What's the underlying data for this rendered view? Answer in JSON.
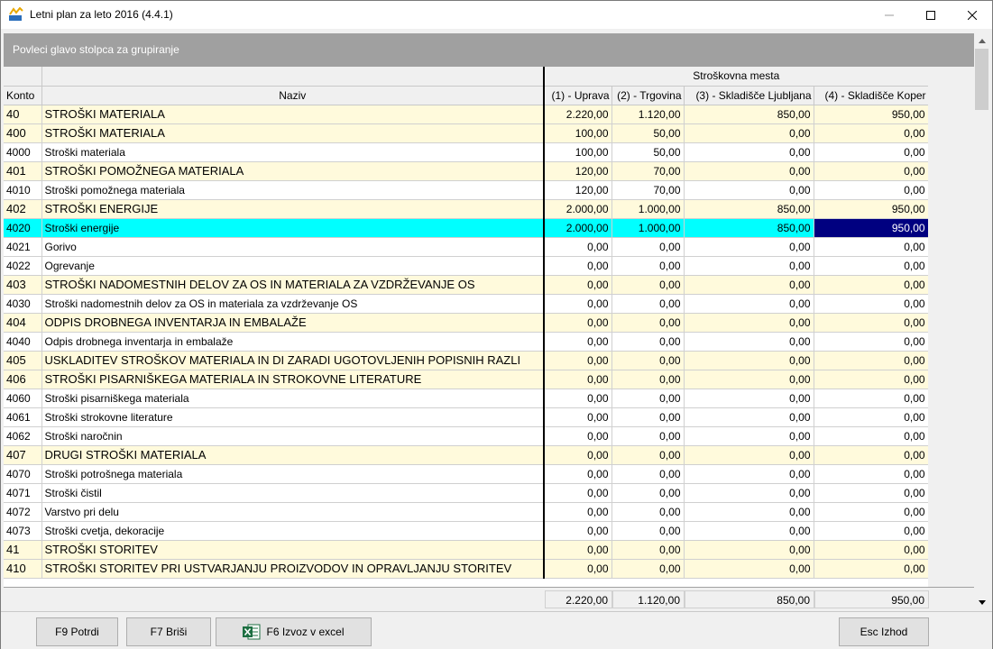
{
  "window": {
    "title": "Letni plan za leto 2016  (4.4.1)"
  },
  "group_bar": {
    "text": "Povleci glavo stolpca za grupiranje"
  },
  "header": {
    "band": "Stroškovna mesta",
    "columns": [
      "Konto",
      "Naziv",
      "(1) - Uprava",
      "(2) - Trgovina",
      "(3) - Skladišče Ljubljana",
      "(4) - Skladišče Koper"
    ]
  },
  "rows": [
    {
      "type": "grp",
      "konto": "40",
      "naziv": "STROŠKI MATERIALA",
      "v1": "2.220,00",
      "v2": "1.120,00",
      "v3": "850,00",
      "v4": "950,00"
    },
    {
      "type": "grp",
      "konto": "400",
      "naziv": "STROŠKI MATERIALA",
      "v1": "100,00",
      "v2": "50,00",
      "v3": "0,00",
      "v4": "0,00"
    },
    {
      "type": "normal",
      "konto": "4000",
      "naziv": "Stroški materiala",
      "v1": "100,00",
      "v2": "50,00",
      "v3": "0,00",
      "v4": "0,00"
    },
    {
      "type": "grp",
      "konto": "401",
      "naziv": "STROŠKI POMOŽNEGA MATERIALA",
      "v1": "120,00",
      "v2": "70,00",
      "v3": "0,00",
      "v4": "0,00"
    },
    {
      "type": "normal",
      "konto": "4010",
      "naziv": "Stroški pomožnega materiala",
      "v1": "120,00",
      "v2": "70,00",
      "v3": "0,00",
      "v4": "0,00"
    },
    {
      "type": "grp",
      "konto": "402",
      "naziv": "STROŠKI ENERGIJE",
      "v1": "2.000,00",
      "v2": "1.000,00",
      "v3": "850,00",
      "v4": "950,00"
    },
    {
      "type": "sel",
      "konto": "4020",
      "naziv": "Stroški energije",
      "v1": "2.000,00",
      "v2": "1.000,00",
      "v3": "850,00",
      "v4": "950,00"
    },
    {
      "type": "normal",
      "konto": "4021",
      "naziv": "Gorivo",
      "v1": "0,00",
      "v2": "0,00",
      "v3": "0,00",
      "v4": "0,00"
    },
    {
      "type": "normal",
      "konto": "4022",
      "naziv": "Ogrevanje",
      "v1": "0,00",
      "v2": "0,00",
      "v3": "0,00",
      "v4": "0,00"
    },
    {
      "type": "grp",
      "konto": "403",
      "naziv": "STROŠKI NADOMESTNIH DELOV ZA OS IN MATERIALA ZA VZDRŽEVANJE OS",
      "v1": "0,00",
      "v2": "0,00",
      "v3": "0,00",
      "v4": "0,00"
    },
    {
      "type": "normal",
      "konto": "4030",
      "naziv": "Stroški nadomestnih delov za OS in materiala za vzdrževanje OS",
      "v1": "0,00",
      "v2": "0,00",
      "v3": "0,00",
      "v4": "0,00"
    },
    {
      "type": "grp",
      "konto": "404",
      "naziv": "ODPIS DROBNEGA INVENTARJA IN EMBALAŽE",
      "v1": "0,00",
      "v2": "0,00",
      "v3": "0,00",
      "v4": "0,00"
    },
    {
      "type": "normal",
      "konto": "4040",
      "naziv": "Odpis drobnega inventarja in embalaže",
      "v1": "0,00",
      "v2": "0,00",
      "v3": "0,00",
      "v4": "0,00"
    },
    {
      "type": "grp",
      "konto": "405",
      "naziv": "USKLADITEV STROŠKOV MATERIALA IN DI ZARADI UGOTOVLJENIH POPISNIH RAZLI",
      "v1": "0,00",
      "v2": "0,00",
      "v3": "0,00",
      "v4": "0,00"
    },
    {
      "type": "grp",
      "konto": "406",
      "naziv": "STROŠKI PISARNIŠKEGA MATERIALA IN STROKOVNE LITERATURE",
      "v1": "0,00",
      "v2": "0,00",
      "v3": "0,00",
      "v4": "0,00"
    },
    {
      "type": "normal",
      "konto": "4060",
      "naziv": "Stroški pisarniškega materiala",
      "v1": "0,00",
      "v2": "0,00",
      "v3": "0,00",
      "v4": "0,00"
    },
    {
      "type": "normal",
      "konto": "4061",
      "naziv": "Stroški strokovne literature",
      "v1": "0,00",
      "v2": "0,00",
      "v3": "0,00",
      "v4": "0,00"
    },
    {
      "type": "normal",
      "konto": "4062",
      "naziv": "Stroški naročnin",
      "v1": "0,00",
      "v2": "0,00",
      "v3": "0,00",
      "v4": "0,00"
    },
    {
      "type": "grp",
      "konto": "407",
      "naziv": "DRUGI STROŠKI MATERIALA",
      "v1": "0,00",
      "v2": "0,00",
      "v3": "0,00",
      "v4": "0,00"
    },
    {
      "type": "normal",
      "konto": "4070",
      "naziv": "Stroški potrošnega materiala",
      "v1": "0,00",
      "v2": "0,00",
      "v3": "0,00",
      "v4": "0,00"
    },
    {
      "type": "normal",
      "konto": "4071",
      "naziv": "Stroški čistil",
      "v1": "0,00",
      "v2": "0,00",
      "v3": "0,00",
      "v4": "0,00"
    },
    {
      "type": "normal",
      "konto": "4072",
      "naziv": "Varstvo pri delu",
      "v1": "0,00",
      "v2": "0,00",
      "v3": "0,00",
      "v4": "0,00"
    },
    {
      "type": "normal",
      "konto": "4073",
      "naziv": "Stroški cvetja, dekoracije",
      "v1": "0,00",
      "v2": "0,00",
      "v3": "0,00",
      "v4": "0,00"
    },
    {
      "type": "grp",
      "konto": "41",
      "naziv": "STROŠKI STORITEV",
      "v1": "0,00",
      "v2": "0,00",
      "v3": "0,00",
      "v4": "0,00"
    },
    {
      "type": "grp",
      "konto": "410",
      "naziv": "STROŠKI STORITEV PRI USTVARJANJU PROIZVODOV IN OPRAVLJANJU STORITEV",
      "v1": "0,00",
      "v2": "0,00",
      "v3": "0,00",
      "v4": "0,00"
    }
  ],
  "totals": {
    "v1": "2.220,00",
    "v2": "1.120,00",
    "v3": "850,00",
    "v4": "950,00"
  },
  "buttons": {
    "confirm": "F9 Potrdi",
    "delete": "F7 Briši",
    "export": "F6 Izvoz v excel",
    "exit": "Esc Izhod"
  }
}
